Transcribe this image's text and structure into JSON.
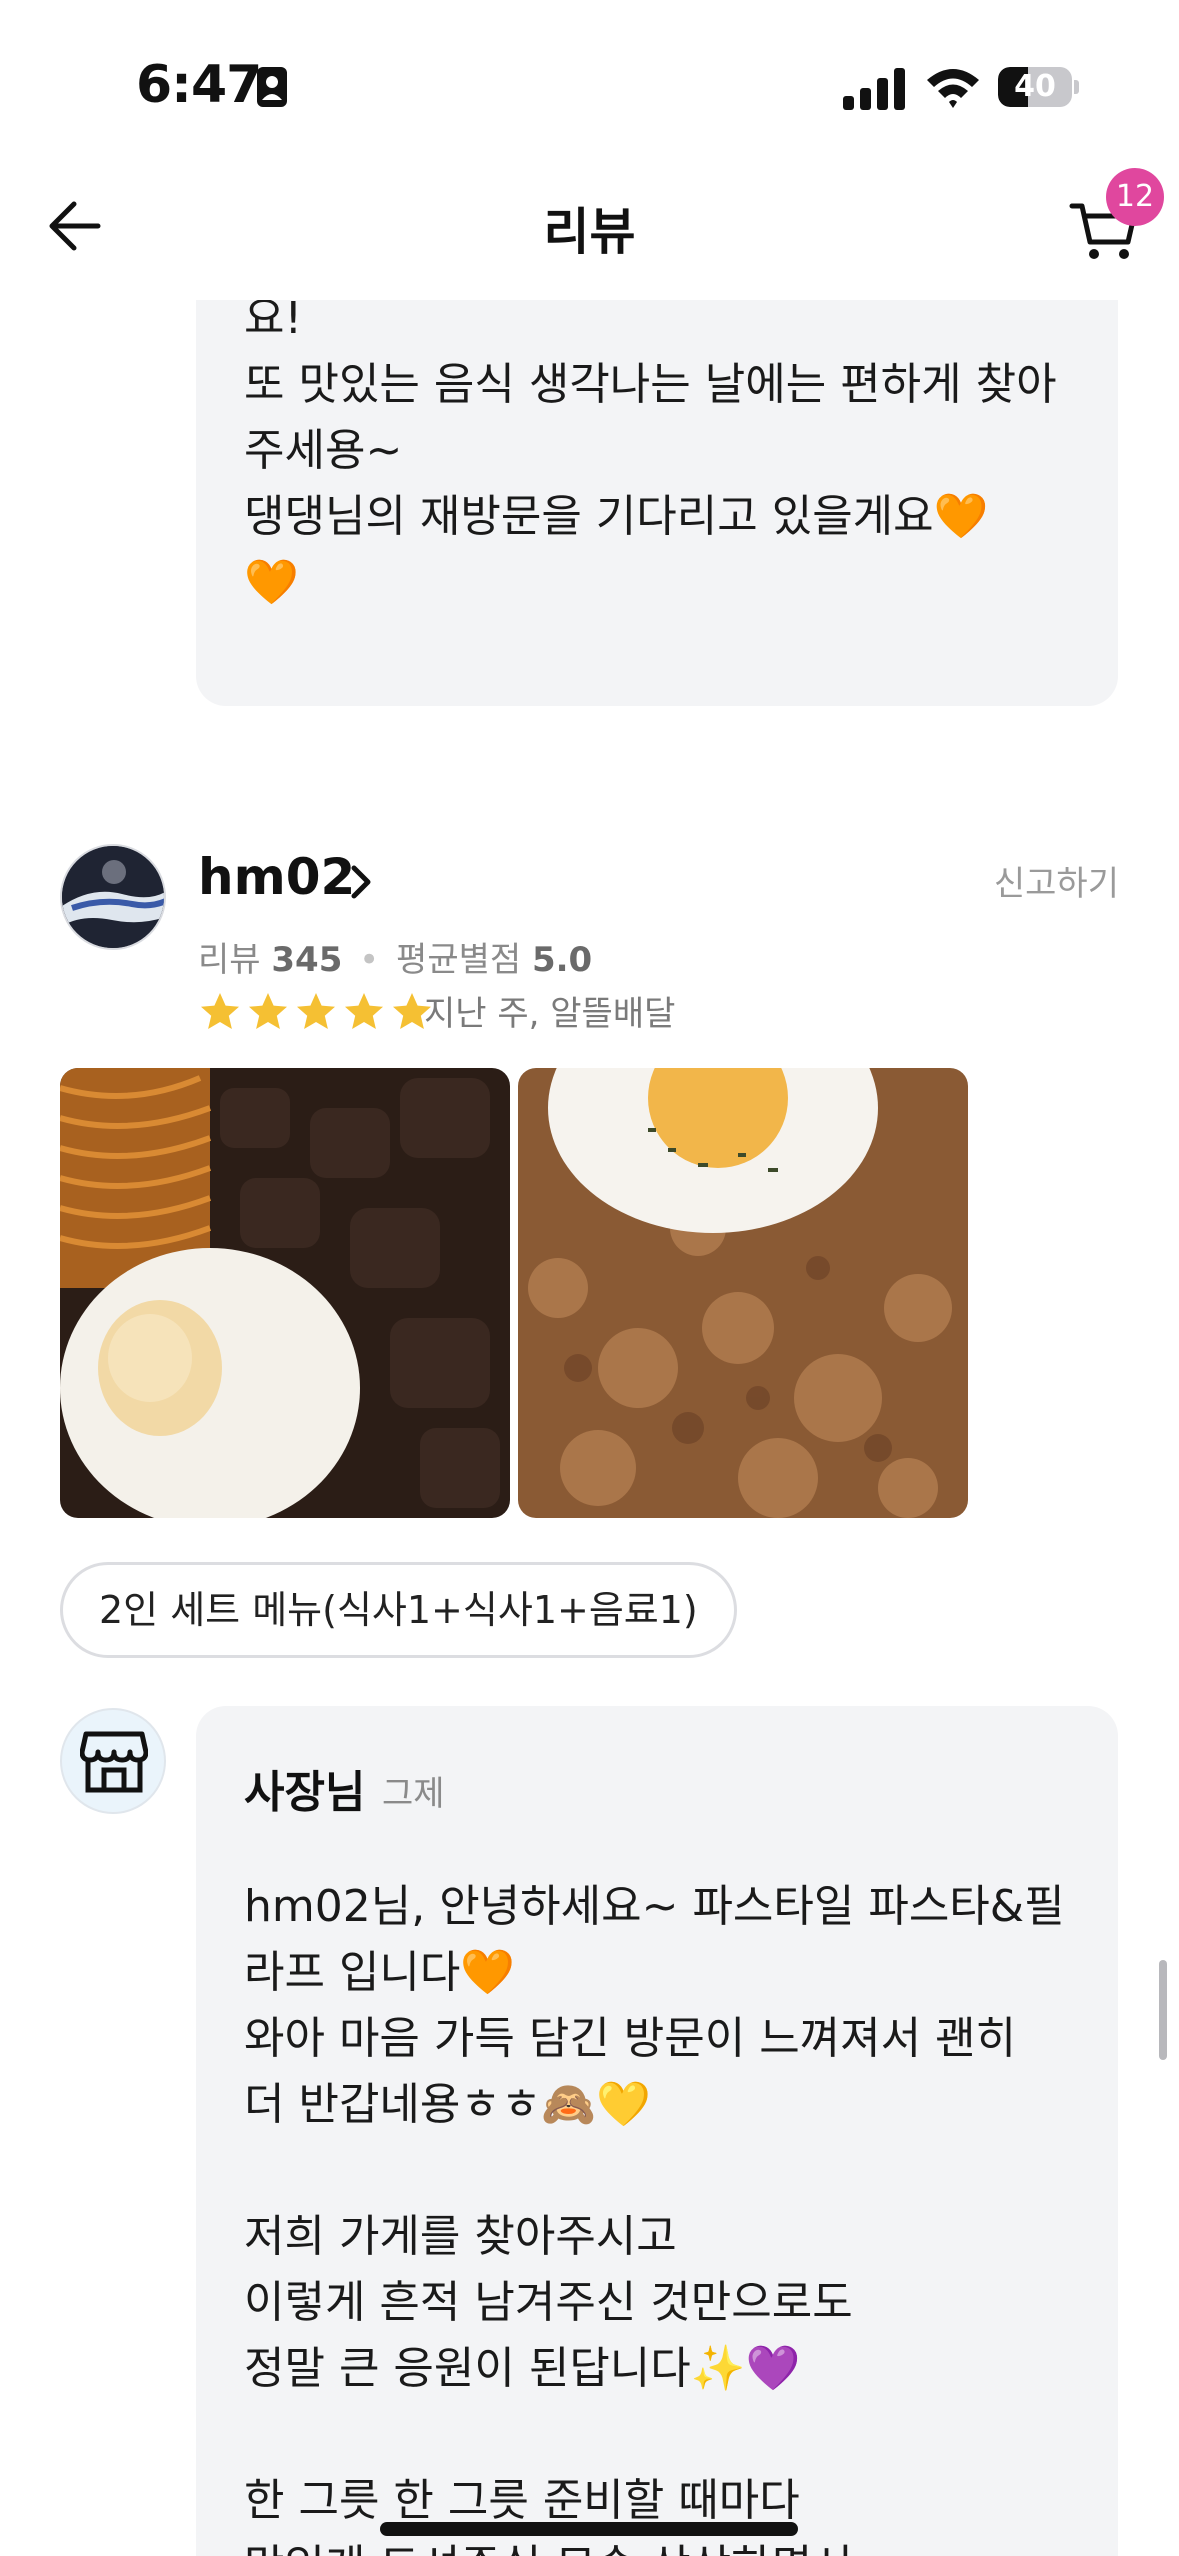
{
  "status_bar": {
    "time": "6:47",
    "battery": "40",
    "battery_level": 0.4
  },
  "header": {
    "title": "리뷰",
    "cart_count": "12"
  },
  "previous_reply": {
    "text": "기분 좋은 식사가 되도록 꼼꼼하게 준비할게\n요!\n또 맛있는 음식 생각나는 날에는 편하게 찾아\n주세용~\n댕댕님의 재방문을 기다리고 있을게요🧡\n🧡"
  },
  "review": {
    "reviewer_name": "hm02",
    "report_label": "신고하기",
    "stats_review_label": "리뷰",
    "stats_review_count": "345",
    "stats_rating_label": "평균별점",
    "stats_rating_value": "5.0",
    "rating": 5,
    "meta": "지난 주, 알뜰배달",
    "photos": [
      "pasta-steak-egg",
      "fried-rice-egg"
    ],
    "menu": "2인 세트 메뉴(식사1+식사1+음료1)"
  },
  "owner_reply": {
    "name": "사장님",
    "date": "그제",
    "text": "hm02님, 안녕하세요~ 파스타일 파스타&필\n라프 입니다🧡\n와아 마음 가득 담긴 방문이 느껴져서 괜히\n더 반갑네용ㅎㅎ🙈💛\n\n저희 가게를 찾아주시고\n이렇게 흔적 남겨주신 것만으로도\n정말 큰 응원이 된답니다✨💜\n\n한 그릇 한 그릇 준비할 때마다\n맛있게 드셔주실 모습 상상하면서"
  },
  "colors": {
    "badge": "#e0479e",
    "star": "#f5c033",
    "bubble": "#f3f4f6"
  }
}
